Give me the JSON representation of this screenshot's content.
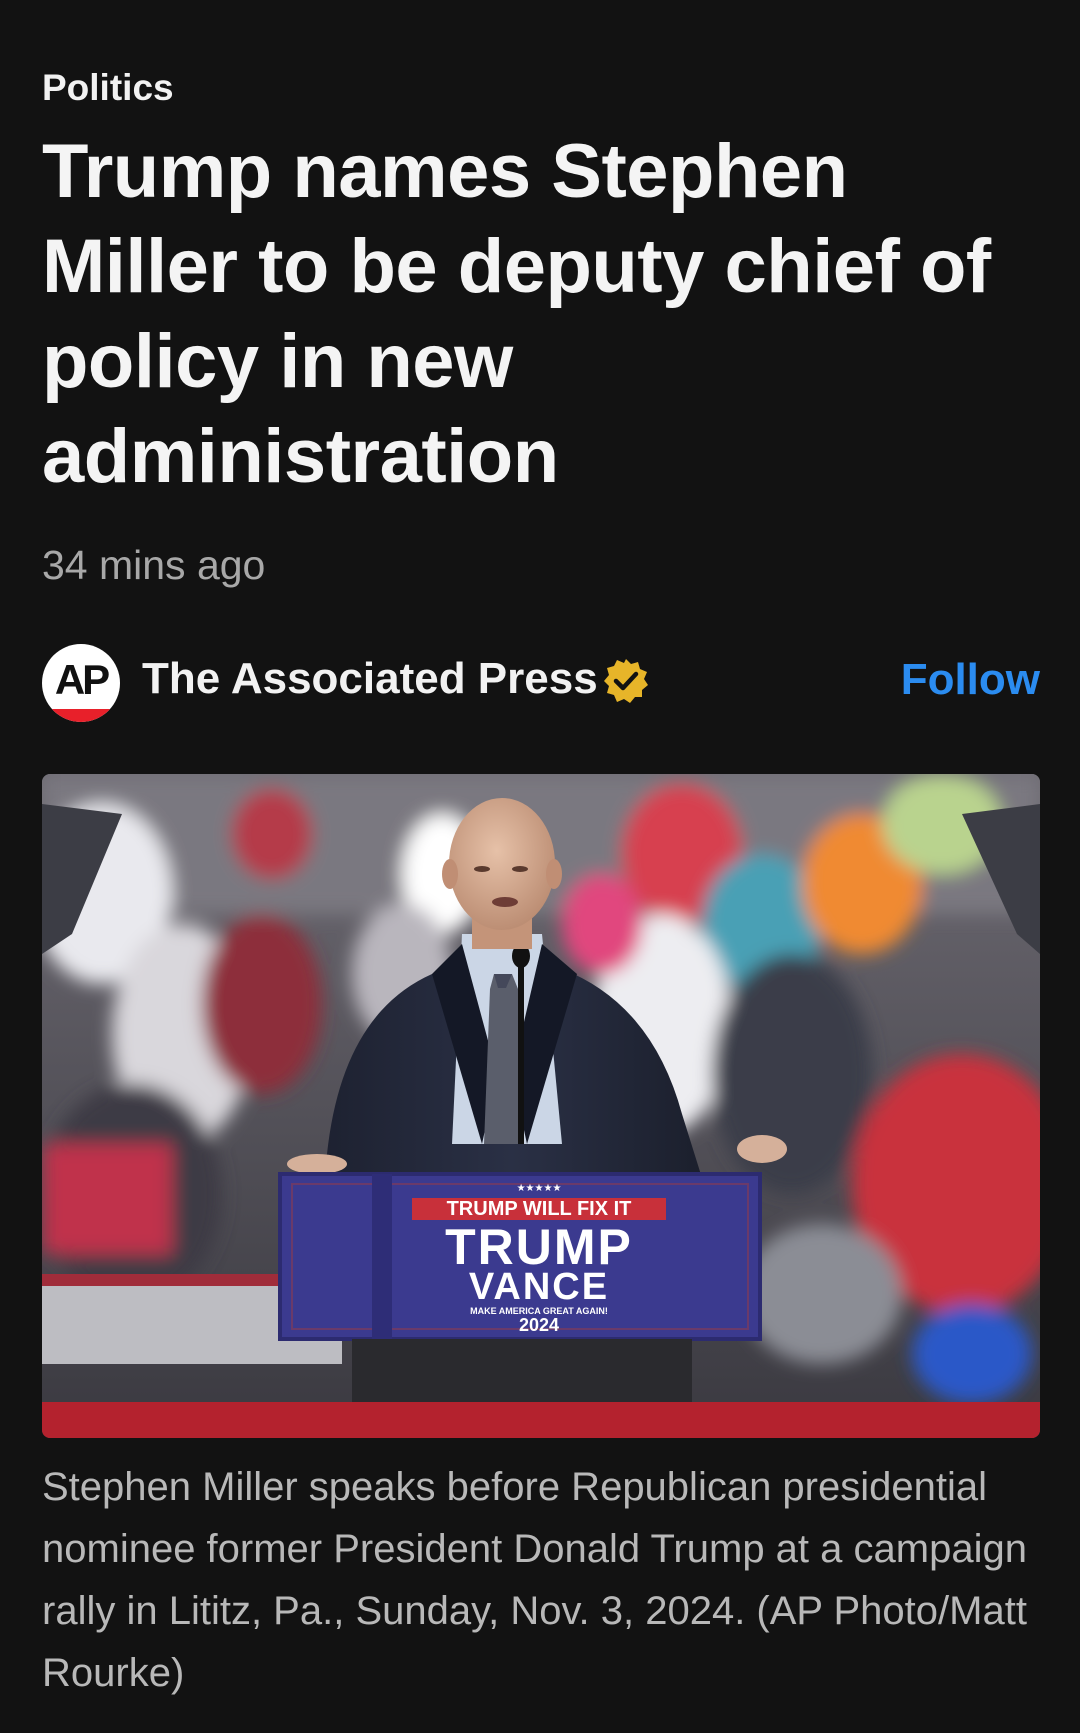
{
  "article": {
    "category": "Politics",
    "headline": "Trump names Stephen Miller to be deputy chief of policy in new administration",
    "timestamp": "34 mins ago"
  },
  "source": {
    "logo_text": "AP",
    "name": "The Associated Press",
    "verified_icon": "verified-badge-icon",
    "follow_label": "Follow"
  },
  "photo": {
    "podium_slogan": "TRUMP WILL FIX IT",
    "podium_name_1": "TRUMP",
    "podium_name_2": "VANCE",
    "podium_tagline": "MAKE AMERICA GREAT AGAIN!",
    "podium_year": "2024",
    "podium_stars": "★★★★★"
  },
  "caption": "Stephen Miller speaks before Republican presidential nominee former President Donald Trump at a campaign rally in Lititz, Pa., Sunday, Nov. 3, 2024. (AP Photo/Matt Rourke)",
  "colors": {
    "background": "#121212",
    "accent": "#2b8cf0",
    "verified": "#e7b529",
    "ap_red": "#e8202a"
  }
}
